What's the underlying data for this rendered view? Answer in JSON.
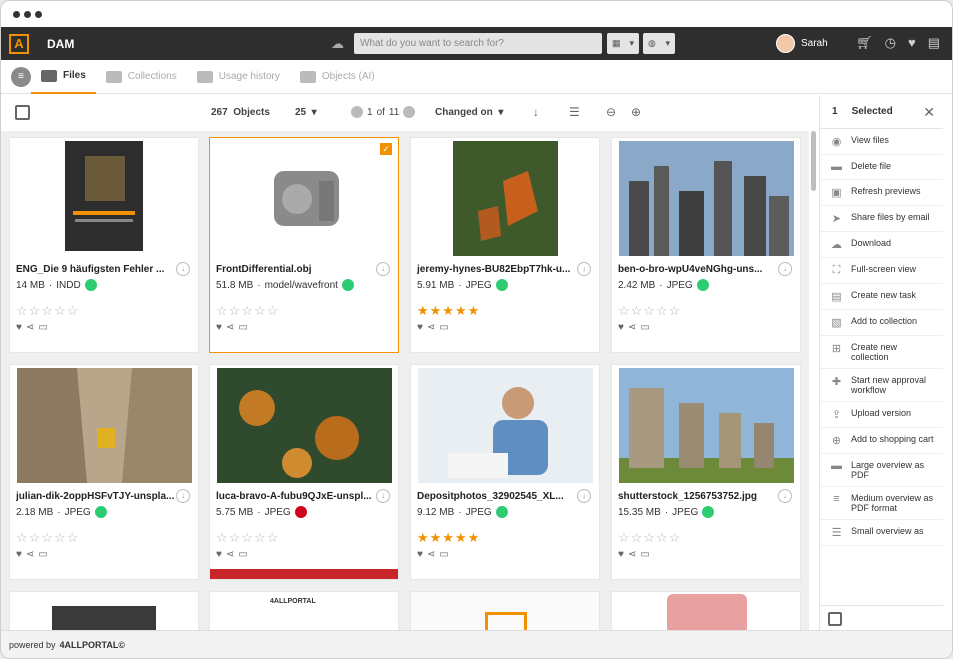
{
  "app": {
    "title": "DAM",
    "logo": "A"
  },
  "search": {
    "placeholder": "What do you want to search for?"
  },
  "user": {
    "name": "Sarah"
  },
  "tabs": [
    {
      "label": "Files",
      "active": true
    },
    {
      "label": "Collections"
    },
    {
      "label": "Usage history"
    },
    {
      "label": "Objects (AI)"
    }
  ],
  "toolbar": {
    "count": "267",
    "count_label": "Objects",
    "per_page": "25",
    "page_current": "1",
    "page_of": "of",
    "page_total": "11",
    "sort": "Changed on"
  },
  "cards": [
    {
      "name": "ENG_Die 9 häufigsten Fehler ...",
      "size": "14 MB",
      "type": "INDD",
      "status": "green",
      "rating": 0
    },
    {
      "name": "FrontDifferential.obj",
      "size": "51.8 MB",
      "type": "model/wavefront",
      "status": "green",
      "rating": 0,
      "selected": true
    },
    {
      "name": "jeremy-hynes-BU82EbpT7hk-u...",
      "size": "5.91 MB",
      "type": "JPEG",
      "status": "green",
      "rating": 5
    },
    {
      "name": "ben-o-bro-wpU4veNGhg-uns...",
      "size": "2.42 MB",
      "type": "JPEG",
      "status": "green",
      "rating": 0
    },
    {
      "name": "julian-dik-2oppHSFvTJY-unspla...",
      "size": "2.18 MB",
      "type": "JPEG",
      "status": "green",
      "rating": 0
    },
    {
      "name": "luca-bravo-A-fubu9QJxE-unspl...",
      "size": "5.75 MB",
      "type": "JPEG",
      "status": "red",
      "rating": 0,
      "redbar": true
    },
    {
      "name": "Depositphotos_32902545_XL...",
      "size": "9.12 MB",
      "type": "JPEG",
      "status": "green",
      "rating": 5
    },
    {
      "name": "shutterstock_1256753752.jpg",
      "size": "15.35 MB",
      "type": "JPEG",
      "status": "green",
      "rating": 0
    }
  ],
  "partial_cards": [
    {
      "label": "4ALLPORTAL"
    },
    {
      "label": "4ALLPORTAL"
    }
  ],
  "sidebar": {
    "count": "1",
    "title": "Selected",
    "items": [
      {
        "label": "View files",
        "icon": "eye-icon"
      },
      {
        "label": "Delete file",
        "icon": "trash-icon"
      },
      {
        "label": "Refresh previews",
        "icon": "image-icon"
      },
      {
        "label": "Share files by email",
        "icon": "send-icon"
      },
      {
        "label": "Download",
        "icon": "cloud-download-icon"
      },
      {
        "label": "Full-screen view",
        "icon": "fullscreen-icon"
      },
      {
        "label": "Create new task",
        "icon": "task-icon"
      },
      {
        "label": "Add to collection",
        "icon": "collection-icon"
      },
      {
        "label": "Create new collection",
        "icon": "add-collection-icon"
      },
      {
        "label": "Start new approval workflow",
        "icon": "approval-icon"
      },
      {
        "label": "Upload version",
        "icon": "upload-icon"
      },
      {
        "label": "Add to shopping cart",
        "icon": "cart-icon"
      },
      {
        "label": "Large overview as PDF",
        "icon": "pdf-large-icon"
      },
      {
        "label": "Medium overview as PDF format",
        "icon": "pdf-medium-icon"
      },
      {
        "label": "Small overview as",
        "icon": "pdf-small-icon"
      }
    ]
  },
  "footer": {
    "powered_by": "powered by",
    "brand": "4ALLPORTAL©"
  },
  "colors": {
    "accent": "#f29100",
    "topbar": "#2e2e2e",
    "status_green": "#2ecc71",
    "status_red": "#d0021b"
  }
}
